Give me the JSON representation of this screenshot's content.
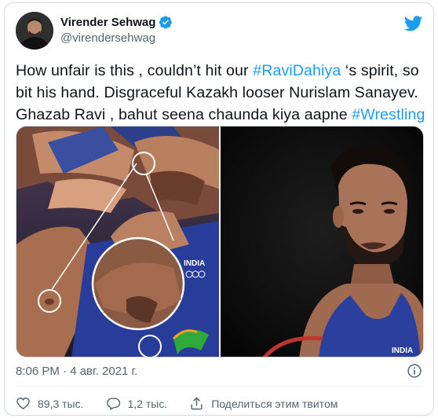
{
  "author": {
    "name": "Virender Sehwag",
    "handle": "@virendersehwag"
  },
  "tweet": {
    "text_parts": [
      {
        "type": "text",
        "value": "How unfair is this , couldn’t hit our "
      },
      {
        "type": "hashtag",
        "value": "#RaviDahiya"
      },
      {
        "type": "text",
        "value": " ‘s spirit, so bit his hand. Disgraceful Kazakh looser Nurislam Sanayev. Ghazab Ravi , bahut seena chaunda kiya aapne "
      },
      {
        "type": "hashtag",
        "value": "#Wrestling"
      }
    ]
  },
  "media": {
    "left_singlet_text": "INDIA",
    "right_singlet_text": "INDIA"
  },
  "meta": {
    "timestamp": "8:06 PM · 4 авг. 2021 г."
  },
  "actions": {
    "likes": "89,3 тыс.",
    "replies": "1,2 тыс.",
    "share_label": "Поделиться этим твитом"
  },
  "colors": {
    "accent": "#1d9bf0",
    "text": "#0f1419",
    "secondary": "#536471",
    "border": "#cfd9de"
  }
}
